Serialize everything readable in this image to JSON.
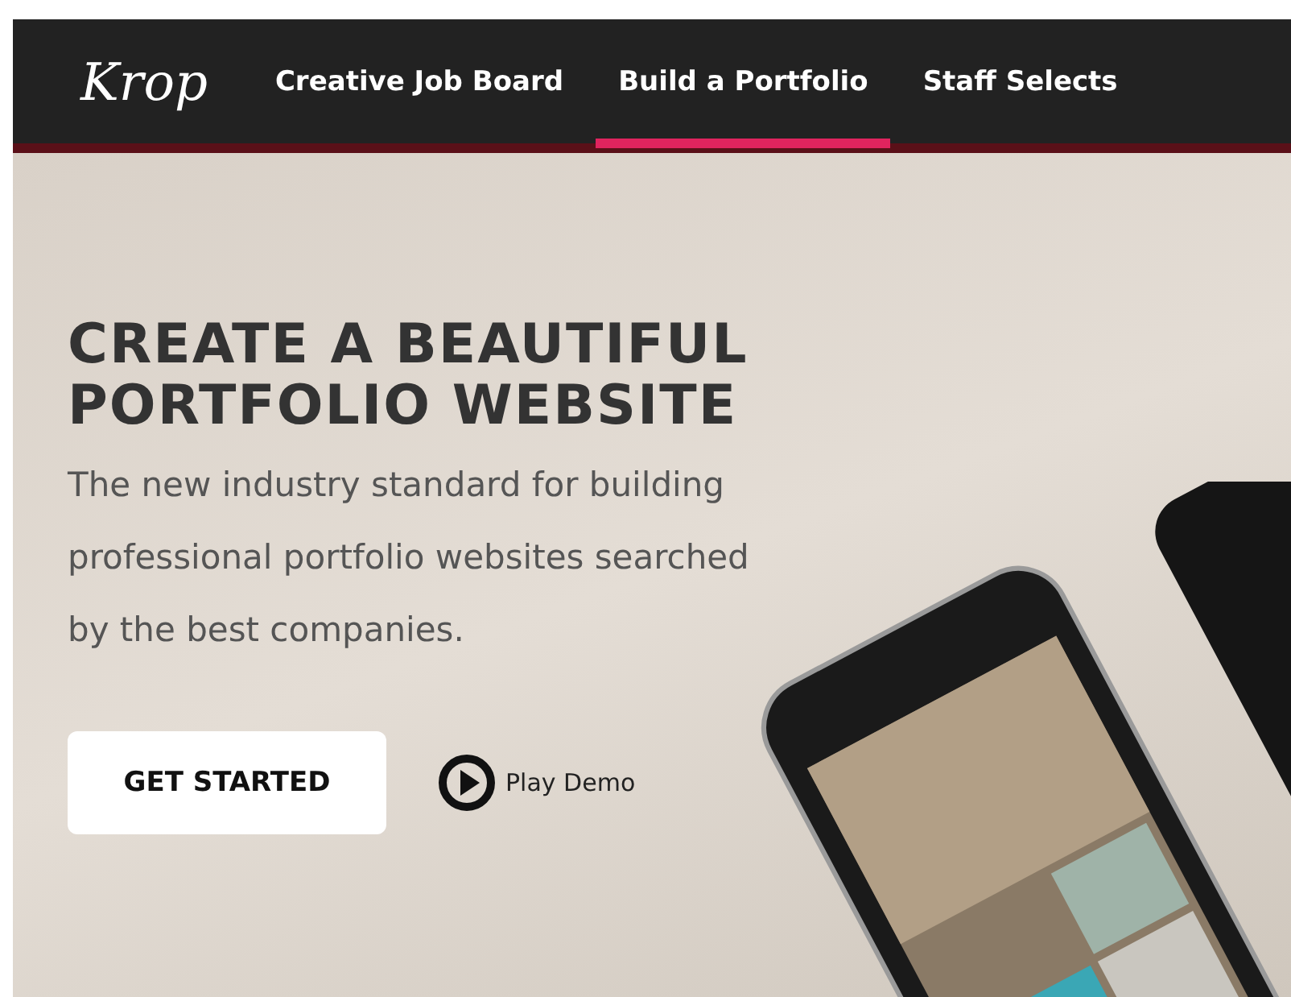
{
  "header": {
    "logo": "Krop",
    "nav": [
      {
        "label": "Creative Job Board",
        "selected": false
      },
      {
        "label": "Build a Portfolio",
        "selected": true
      },
      {
        "label": "Staff Selects",
        "selected": false
      }
    ]
  },
  "hero": {
    "title_lines": [
      "CREATE A BEAUTIFUL",
      "PORTFOLIO WEBSITE"
    ],
    "description": "The new industry standard for building professional portfolio websites searched by the best companies.",
    "primary_button": "GET STARTED",
    "demo_link": "Play Demo"
  }
}
